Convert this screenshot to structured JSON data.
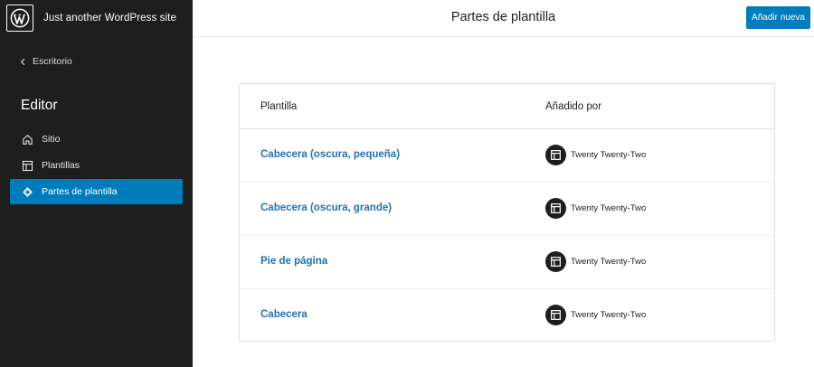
{
  "sidebar": {
    "site_title": "Just another WordPress site",
    "back_label": "Escritorio",
    "editor_title": "Editor",
    "items": [
      {
        "label": "Sitio",
        "icon": "home-icon"
      },
      {
        "label": "Plantillas",
        "icon": "layout-icon"
      },
      {
        "label": "Partes de plantilla",
        "icon": "symbol-icon",
        "active": true
      }
    ]
  },
  "header": {
    "title": "Partes de plantilla",
    "add_new_label": "Añadir nueva"
  },
  "table": {
    "columns": [
      "Plantilla",
      "Añadido por"
    ],
    "rows": [
      {
        "name": "Cabecera (oscura, pequeña)",
        "author": "Twenty Twenty-Two"
      },
      {
        "name": "Cabecera (oscura, grande)",
        "author": "Twenty Twenty-Two"
      },
      {
        "name": "Pie de página",
        "author": "Twenty Twenty-Two"
      },
      {
        "name": "Cabecera",
        "author": "Twenty Twenty-Two"
      }
    ]
  },
  "colors": {
    "sidebar_bg": "#1e1e1e",
    "accent": "#007cba",
    "link": "#2271b1"
  }
}
